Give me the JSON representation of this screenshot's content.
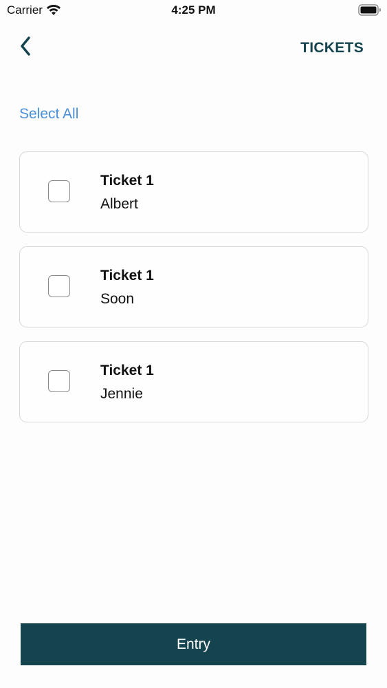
{
  "status_bar": {
    "carrier": "Carrier",
    "time": "4:25 PM",
    "icons": [
      "wifi-icon",
      "battery-icon"
    ]
  },
  "header": {
    "back_icon": "chevron-left-icon",
    "title": "TICKETS"
  },
  "select_all_label": "Select All",
  "tickets": [
    {
      "title": "Ticket 1",
      "name": "Albert",
      "checked": false
    },
    {
      "title": "Ticket 1",
      "name": "Soon",
      "checked": false
    },
    {
      "title": "Ticket 1",
      "name": "Jennie",
      "checked": false
    }
  ],
  "entry_label": "Entry",
  "colors": {
    "primary": "#15444f",
    "link": "#4a8fd8",
    "card_border": "#d9d6de",
    "background": "#fdfdfd"
  }
}
